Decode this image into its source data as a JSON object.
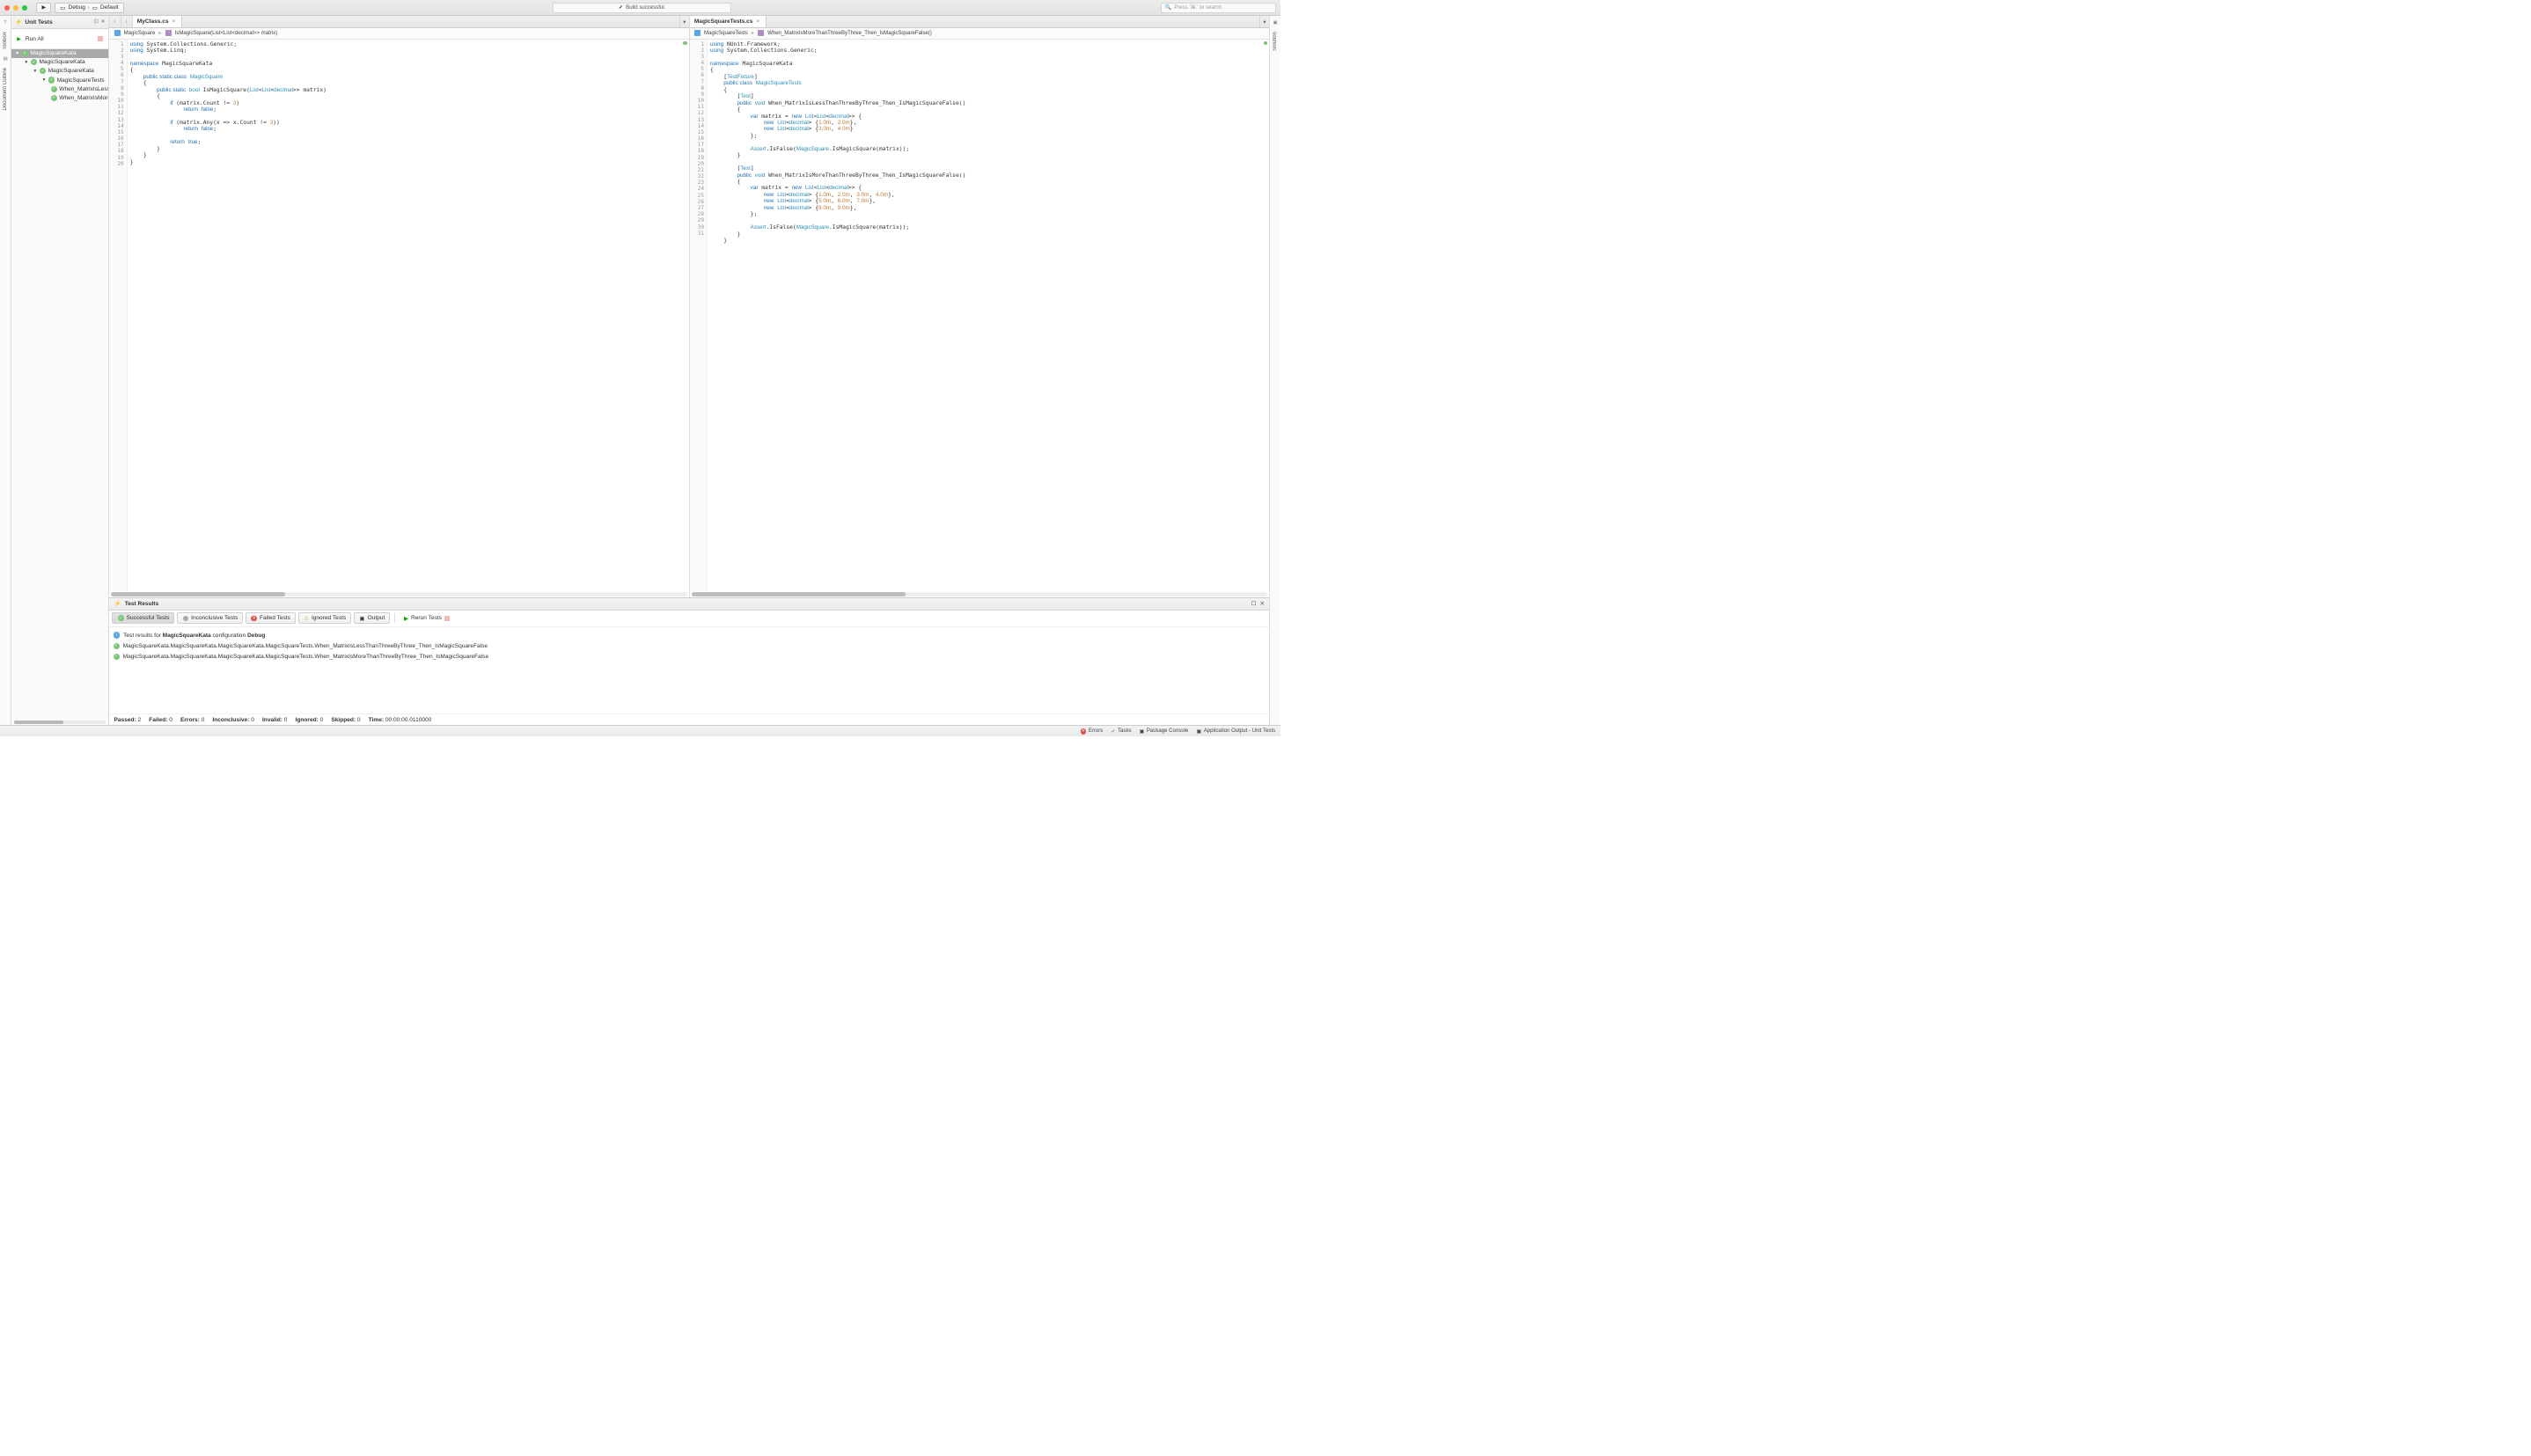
{
  "toolbar": {
    "config": "Debug",
    "target": "Default",
    "status": "Build successful.",
    "search_placeholder": "Press '⌘.' to search"
  },
  "leftside": {
    "toolbox": "Toolbox",
    "outline": "Document Outline"
  },
  "rightside": {
    "solution": "Solution"
  },
  "unittests": {
    "title": "Unit Tests",
    "runall": "Run All",
    "root": "MagicSquareKata",
    "proj": "MagicSquareKata",
    "ns": "MagicSquareKata",
    "cls": "MagicSquareTests",
    "t1": "When_MatrixIsLessThanThreeByThree_Then_IsMagicSquareFalse",
    "t2": "When_MatrixIsMoreThanThreeByThree_Then_IsMagicSquareFalse"
  },
  "left_editor": {
    "tab": "MyClass.cs",
    "crumb_ns": "MagicSquare",
    "crumb_m": "IsMagicSquare(List<List<decimal>> matrix)",
    "lines": 20
  },
  "right_editor": {
    "tab": "MagicSquareTests.cs",
    "crumb_ns": "MagicSquareTests",
    "crumb_m": "When_MatrixIsMoreThanThreeByThree_Then_IsMagicSquareFalse()",
    "lines": 31
  },
  "results": {
    "title": "Test Results",
    "filters": {
      "success": "Successful Tests",
      "inconclusive": "Inconclusive Tests",
      "failed": "Failed Tests",
      "ignored": "Ignored Tests",
      "output": "Output",
      "rerun": "Rerun Tests"
    },
    "info_prefix": "Test results for ",
    "info_proj": "MagicSquareKata",
    "info_mid": " configuration ",
    "info_cfg": "Debug",
    "r1": "MagicSquareKata.MagicSquareKata.MagicSquareKata.MagicSquareTests.When_MatrixIsLessThanThreeByThree_Then_IsMagicSquareFalse",
    "r2": "MagicSquareKata.MagicSquareKata.MagicSquareKata.MagicSquareTests.When_MatrixIsMoreThanThreeByThree_Then_IsMagicSquareFalse",
    "foot": {
      "passed_l": "Passed:",
      "passed": "2",
      "failed_l": "Failed:",
      "failed": "0",
      "errors_l": "Errors:",
      "errors": "0",
      "inconc_l": "Inconclusive:",
      "inconc": "0",
      "invalid_l": "Invalid:",
      "invalid": "0",
      "ignored_l": "Ignored:",
      "ignored": "0",
      "skipped_l": "Skipped:",
      "skipped": "0",
      "time_l": "Time:",
      "time": "00:00:00.0110000"
    }
  },
  "bottombar": {
    "errors": "Errors",
    "tasks": "Tasks",
    "pkg": "Package Console",
    "appout": "Application Output - Unit Tests"
  }
}
